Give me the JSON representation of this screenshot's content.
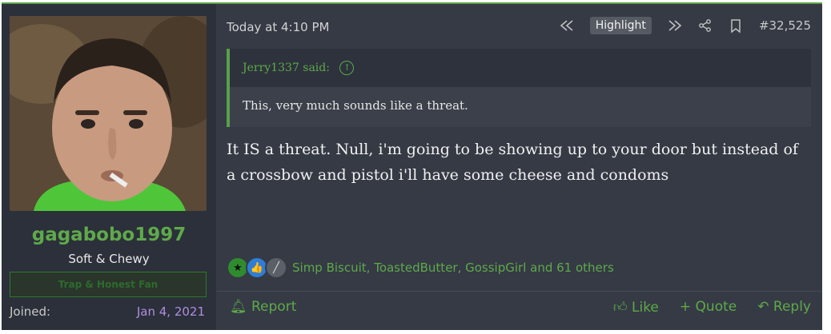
{
  "user": {
    "name": "gagabobo1997",
    "title": "Soft & Chewy",
    "banner": "Trap & Honest Fan",
    "joined_label": "Joined:",
    "joined_value": "Jan 4, 2021"
  },
  "post": {
    "timestamp": "Today at 4:10 PM",
    "highlight_label": "Highlight",
    "number": "#32,525",
    "quote_author": "Jerry1337 said:",
    "quote_text": "This, very much sounds like a threat.",
    "message": "It IS a threat. Null, i'm going to be showing up to your door but instead of a crossbow and pistol i'll have some cheese and condoms"
  },
  "reactions": {
    "users": "Simp Biscuit, ToastedButter, GossipGirl and 61 others"
  },
  "footer": {
    "report": "Report",
    "like": "Like",
    "quote": "+ Quote",
    "reply": "Reply"
  },
  "colors": {
    "accent_green": "#5fa94a",
    "background": "#353a45",
    "user_column": "#2b303a",
    "joined_date": "#b38ce0"
  },
  "icons": [
    "rewind-icon",
    "fast-forward-icon",
    "share-icon",
    "bookmark-icon",
    "arrow-up-circle-icon",
    "bell-icon",
    "thumbs-up-icon",
    "reply-arrow-icon"
  ]
}
